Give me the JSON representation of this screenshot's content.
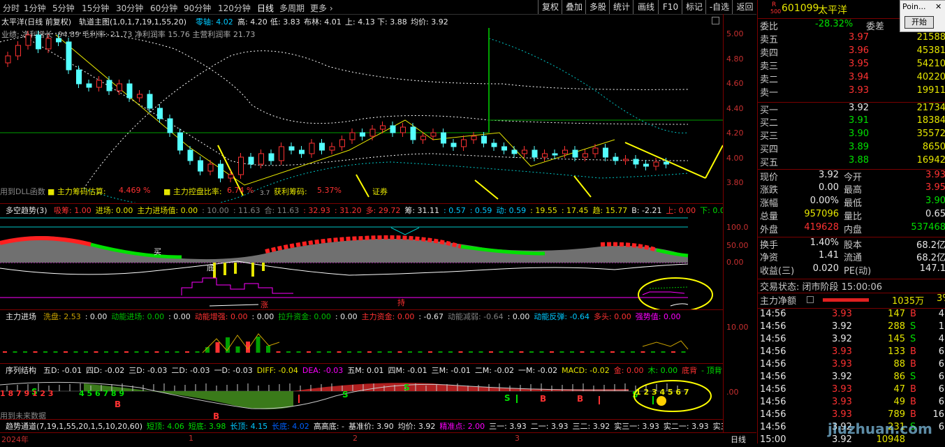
{
  "toolbar": {
    "items": [
      "分时",
      "1分钟",
      "5分钟",
      "15分钟",
      "30分钟",
      "60分钟",
      "90分钟",
      "120分钟",
      "日线",
      "多周期",
      "更多 ›"
    ],
    "right_buttons": [
      "复权",
      "叠加",
      "多股",
      "统计",
      "画线",
      "F10",
      "标记",
      "-自选",
      "返回"
    ]
  },
  "chart_header": {
    "stock": "太平洋(日线 前复权)",
    "indicator": "轨道主图(1,0,1,7,19,1,55,20)",
    "zero_axis": "零轴: 4.02",
    "high": "高: 4.20",
    "low": "低: 3.83",
    "bolling": "布林: 4.01",
    "up": "上: 4.13",
    "down": "下: 3.88",
    "avg": "均价: 3.92",
    "sub_line": "业绩: 净利增长 -94.89 毛利率: 21.73 净利润率 15.76 主营利润率 21.73"
  },
  "main_annotations": {
    "dll": "用到DLL函数",
    "chip_est_label": "■ 主力筹码估算:",
    "chip_est_val": "4.469 %",
    "control_label": "■ 主力控盘比率:",
    "control_val": "6.74 %",
    "profit_label": "获利筹码:",
    "profit_val": "5.37%",
    "securities": "证券",
    "low_mark": "3.7"
  },
  "main_yaxis": [
    "5.00",
    "4.80",
    "4.60",
    "4.40",
    "4.20",
    "4.00",
    "3.80"
  ],
  "panel2": {
    "title": "多空趋势(3)",
    "items": [
      {
        "t": "吸筹: 1.00",
        "c": "#ff3232"
      },
      {
        "t": "进场: 0.00",
        "c": "#e6e600"
      },
      {
        "t": "主力进场值: 0.00",
        "c": "#e6e600"
      },
      {
        "t": ": 10.00",
        "c": "#808080"
      },
      {
        "t": ": 11.63",
        "c": "#808080"
      },
      {
        "t": "合: 11.63",
        "c": "#808080"
      },
      {
        "t": ": 32.93",
        "c": "#ff3232"
      },
      {
        "t": ": 31.20",
        "c": "#ff3232"
      },
      {
        "t": "多: 29.72",
        "c": "#ff3232"
      },
      {
        "t": "筹: 31.11",
        "c": "#e8e8e8"
      },
      {
        "t": ": 0.57",
        "c": "#00c8ff"
      },
      {
        "t": ": 0.59",
        "c": "#00c8ff"
      },
      {
        "t": "动: 0.59",
        "c": "#00c8ff"
      },
      {
        "t": ": 19.55",
        "c": "#e6e600"
      },
      {
        "t": ": 17.45",
        "c": "#e6e600"
      },
      {
        "t": "趋: 15.77",
        "c": "#e6e600"
      },
      {
        "t": "B: -2.21",
        "c": "#e8e8e8"
      },
      {
        "t": "上: 0.00",
        "c": "#ff3232"
      },
      {
        "t": "下: 0.00",
        "c": "#00e000"
      },
      {
        "t": "买",
        "c": "#ff3232"
      }
    ],
    "yaxis": [
      "100.0",
      "50.00",
      "0.00"
    ],
    "marks": {
      "buy": "买",
      "bottom": "底",
      "hold": "持",
      "rise": "涨"
    }
  },
  "panel3": {
    "title": "主力进场",
    "items": [
      {
        "t": "洗盘: 2.53",
        "c": "#c8a000"
      },
      {
        "t": ": 0.00",
        "c": "#e8e8e8"
      },
      {
        "t": "动能进场: 0.00",
        "c": "#00c000"
      },
      {
        "t": ": 0.00",
        "c": "#e8e8e8"
      },
      {
        "t": "动能增强: 0.00",
        "c": "#ff3232"
      },
      {
        "t": ": 0.00",
        "c": "#e8e8e8"
      },
      {
        "t": "拉升资金: 0.00",
        "c": "#00c000"
      },
      {
        "t": ": 0.00",
        "c": "#e8e8e8"
      },
      {
        "t": "主力资金: 0.00",
        "c": "#ff3232"
      },
      {
        "t": ": -0.67",
        "c": "#e8e8e8"
      },
      {
        "t": "动能减弱: -0.64",
        "c": "#808080"
      },
      {
        "t": ": 0.00",
        "c": "#e8e8e8"
      },
      {
        "t": "动能反弹: -0.64",
        "c": "#00c8ff"
      },
      {
        "t": "多头: 0.00",
        "c": "#ff3232"
      },
      {
        "t": "强势值: 0.00",
        "c": "#ff00ff"
      }
    ],
    "yaxis": [
      "10.00"
    ]
  },
  "panel4": {
    "title": "序列结构",
    "items": [
      {
        "t": "五D: -0.01",
        "c": "#e8e8e8"
      },
      {
        "t": "四D: -0.02",
        "c": "#e8e8e8"
      },
      {
        "t": "三D: -0.03",
        "c": "#e8e8e8"
      },
      {
        "t": "二D: -0.03",
        "c": "#e8e8e8"
      },
      {
        "t": "一D: -0.03",
        "c": "#e8e8e8"
      },
      {
        "t": "DIFF: -0.04",
        "c": "#e6e600"
      },
      {
        "t": "DEA: -0.03",
        "c": "#ff00ff"
      },
      {
        "t": "五M: 0.01",
        "c": "#e8e8e8"
      },
      {
        "t": "四M: -0.01",
        "c": "#e8e8e8"
      },
      {
        "t": "三M: -0.01",
        "c": "#e8e8e8"
      },
      {
        "t": "二M: -0.02",
        "c": "#e8e8e8"
      },
      {
        "t": "一M: -0.02",
        "c": "#e8e8e8"
      },
      {
        "t": "MACD: -0.02",
        "c": "#e6e600"
      },
      {
        "t": "金: 0.00",
        "c": "#ff3232"
      },
      {
        "t": "木: 0.00",
        "c": "#00e000"
      },
      {
        "t": "底背",
        "c": "#ff3232"
      },
      {
        "t": "- 顶背",
        "c": "#00e000"
      }
    ],
    "future": "用到未来数据",
    "yaxis": [
      ".00"
    ]
  },
  "panel5": {
    "title": "趋势通道(7,19,1,55,20,1,5,10,20,60)",
    "items": [
      {
        "t": "短顶: 4.06",
        "c": "#00e000"
      },
      {
        "t": "短底: 3.98",
        "c": "#00e000"
      },
      {
        "t": "长顶: 4.15",
        "c": "#00c8ff"
      },
      {
        "t": "长底: 4.02",
        "c": "#0060ff"
      },
      {
        "t": "高高底: -",
        "c": "#e8e8e8"
      },
      {
        "t": "基准价: 3.90",
        "c": "#e8e8e8"
      },
      {
        "t": "均价: 3.92",
        "c": "#e8e8e8"
      },
      {
        "t": "精准点: 2.00",
        "c": "#ff00ff"
      },
      {
        "t": "三一: 3.93",
        "c": "#e8e8e8"
      },
      {
        "t": "二一: 3.93",
        "c": "#e8e8e8"
      },
      {
        "t": "三二: 3.92",
        "c": "#e8e8e8"
      },
      {
        "t": "实三一: 3.93",
        "c": "#e8e8e8"
      },
      {
        "t": "实二一: 3.93",
        "c": "#e8e8e8"
      },
      {
        "t": "实三",
        "c": "#e8e8e8"
      }
    ]
  },
  "timeaxis": {
    "labels": [
      "2024年",
      "1",
      "2",
      "3"
    ],
    "period": "日线"
  },
  "quote": {
    "r_mark": "R",
    "code_small": "500",
    "code": "601099",
    "name": "太平洋",
    "weibi_label": "委比",
    "weibi": "-28.32%",
    "weicha_label": "委差",
    "asks": [
      {
        "l": "卖五",
        "p": "3.97",
        "v": "21588"
      },
      {
        "l": "卖四",
        "p": "3.96",
        "v": "45381"
      },
      {
        "l": "卖三",
        "p": "3.95",
        "v": "54210"
      },
      {
        "l": "卖二",
        "p": "3.94",
        "v": "40220"
      },
      {
        "l": "卖一",
        "p": "3.93",
        "v": "19911"
      }
    ],
    "bids": [
      {
        "l": "买一",
        "p": "3.92",
        "v": "21734"
      },
      {
        "l": "买二",
        "p": "3.91",
        "v": "18384"
      },
      {
        "l": "买三",
        "p": "3.90",
        "v": "35572"
      },
      {
        "l": "买四",
        "p": "3.89",
        "v": "8650"
      },
      {
        "l": "买五",
        "p": "3.88",
        "v": "16942"
      }
    ],
    "stats": [
      {
        "l1": "现价",
        "v1": "3.92",
        "c1": "wht",
        "l2": "今开",
        "v2": "3.93",
        "c2": "red"
      },
      {
        "l1": "涨跌",
        "v1": "0.00",
        "c1": "wht",
        "l2": "最高",
        "v2": "3.95",
        "c2": "red"
      },
      {
        "l1": "涨幅",
        "v1": "0.00%",
        "c1": "wht",
        "l2": "最低",
        "v2": "3.90",
        "c2": "grn"
      },
      {
        "l1": "总量",
        "v1": "957096",
        "c1": "yel",
        "l2": "量比",
        "v2": "0.65",
        "c2": "wht"
      },
      {
        "l1": "外盘",
        "v1": "419628",
        "c1": "red",
        "l2": "内盘",
        "v2": "537468",
        "c2": "grn"
      }
    ],
    "stats2": [
      {
        "l1": "换手",
        "v1": "1.40%",
        "l2": "股本",
        "v2": "68.2亿"
      },
      {
        "l1": "净资",
        "v1": "1.41",
        "l2": "流通",
        "v2": "68.2亿"
      },
      {
        "l1": "收益(三)",
        "v1": "0.020",
        "l2": "PE(动)",
        "v2": "147.1"
      }
    ],
    "status": "交易状态: 闭市阶段 15:00:06",
    "netflow_label": "主力净额",
    "netflow": "1035万",
    "netflow_pct": "3%"
  },
  "ticks": [
    {
      "t": "14:56",
      "p": "3.93",
      "v": "147",
      "d": "B",
      "n": "4"
    },
    {
      "t": "14:56",
      "p": "3.92",
      "v": "288",
      "d": "S",
      "n": "1"
    },
    {
      "t": "14:56",
      "p": "3.92",
      "v": "145",
      "d": "S",
      "n": "4"
    },
    {
      "t": "14:56",
      "p": "3.93",
      "v": "133",
      "d": "B",
      "n": "6"
    },
    {
      "t": "14:56",
      "p": "3.93",
      "v": "88",
      "d": "B",
      "n": "6"
    },
    {
      "t": "14:56",
      "p": "3.92",
      "v": "86",
      "d": "S",
      "n": "6"
    },
    {
      "t": "14:56",
      "p": "3.93",
      "v": "47",
      "d": "B",
      "n": "6"
    },
    {
      "t": "14:56",
      "p": "3.93",
      "v": "49",
      "d": "B",
      "n": "6"
    },
    {
      "t": "14:56",
      "p": "3.93",
      "v": "789",
      "d": "B",
      "n": "16"
    },
    {
      "t": "14:56",
      "p": "3.92",
      "v": "231",
      "d": "S",
      "n": "6"
    },
    {
      "t": "15:00",
      "p": "3.92",
      "v": "10948",
      "d": "",
      "n": ""
    }
  ],
  "popup": {
    "title": "Poin...",
    "button": "开始"
  },
  "watermark": "jiuzhuan.com"
}
